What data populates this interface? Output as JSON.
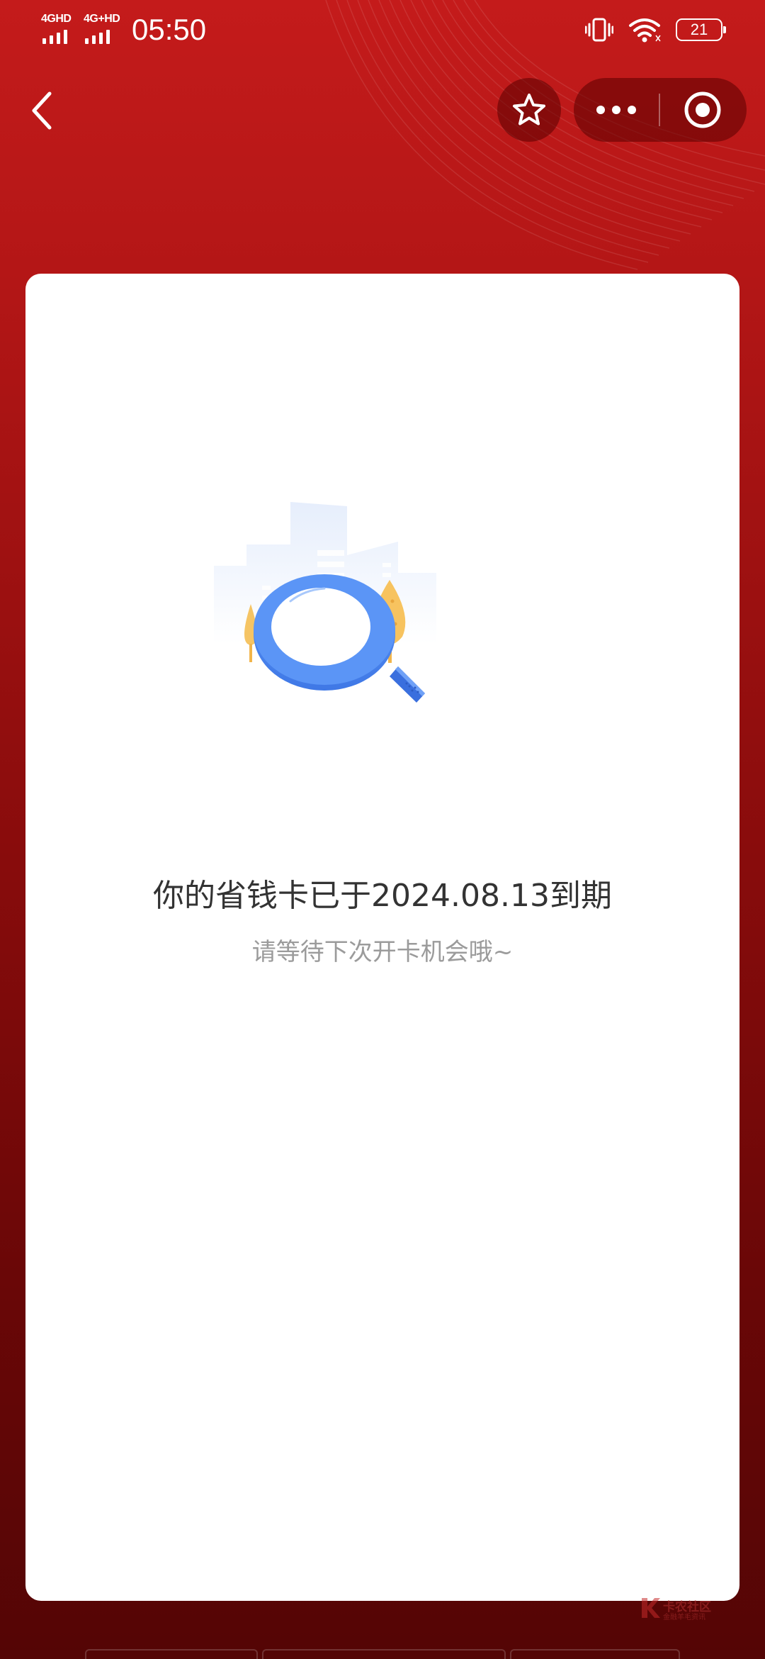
{
  "status_bar": {
    "sim1_label": "4GHD",
    "sim2_label": "4G+HD",
    "time": "05:50",
    "battery": "21",
    "icons": [
      "vibrate-icon",
      "wifi-icon",
      "battery-icon"
    ]
  },
  "nav": {
    "icons": [
      "back-arrow-icon",
      "star-icon",
      "more-dots-icon",
      "close-target-icon"
    ]
  },
  "content": {
    "expired_message": "你的省钱卡已于2024.08.13到期",
    "hint_message": "请等待下次开卡机会哦~"
  },
  "watermark": {
    "title": "卡农社区",
    "subtitle": "金融羊毛资讯"
  },
  "colors": {
    "background_top": "#c41b1b",
    "background_bottom": "#540505",
    "card": "#ffffff",
    "magnifier_blue": "#4a86f2",
    "tree_yellow": "#f7c35f",
    "primary_text": "#333333",
    "secondary_text": "#9b9b9b"
  }
}
